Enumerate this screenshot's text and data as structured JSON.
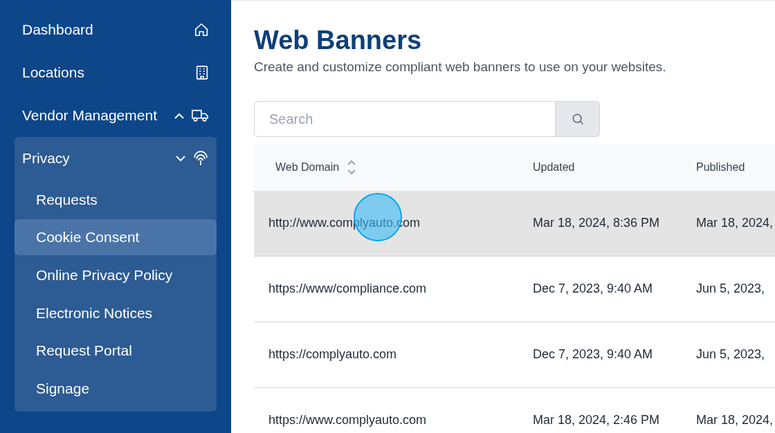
{
  "sidebar": {
    "items": [
      {
        "label": "Dashboard",
        "kind": "link"
      },
      {
        "label": "Locations",
        "kind": "link"
      },
      {
        "label": "Vendor Management",
        "kind": "group",
        "expanded": false
      },
      {
        "label": "Privacy",
        "kind": "group",
        "expanded": true,
        "children": [
          {
            "label": "Requests",
            "selected": false
          },
          {
            "label": "Cookie Consent",
            "selected": true
          },
          {
            "label": "Online Privacy Policy",
            "selected": false
          },
          {
            "label": "Electronic Notices",
            "selected": false
          },
          {
            "label": "Request Portal",
            "selected": false
          },
          {
            "label": "Signage",
            "selected": false
          }
        ]
      }
    ]
  },
  "page": {
    "title": "Web Banners",
    "subtitle": "Create and customize compliant web banners to use on your websites."
  },
  "search": {
    "placeholder": "Search"
  },
  "table": {
    "columns": [
      {
        "label": "Web Domain",
        "sortable": true
      },
      {
        "label": "Updated",
        "sortable": false
      },
      {
        "label": "Published",
        "sortable": false
      }
    ],
    "rows": [
      {
        "selected": true,
        "cells": [
          "http://www.complyauto.com",
          "Mar 18, 2024, 8:36 PM",
          "Mar 18, 2024,"
        ]
      },
      {
        "selected": false,
        "cells": [
          "https://www/compliance.com",
          "Dec 7, 2023, 9:40 AM",
          "Jun 5, 2023,"
        ]
      },
      {
        "selected": false,
        "cells": [
          "https://complyauto.com",
          "Dec 7, 2023, 9:40 AM",
          "Jun 5, 2023,"
        ]
      },
      {
        "selected": false,
        "cells": [
          "https://www.complyauto.com",
          "Mar 18, 2024, 2:46 PM",
          "Mar 18, 2024,"
        ]
      }
    ]
  }
}
